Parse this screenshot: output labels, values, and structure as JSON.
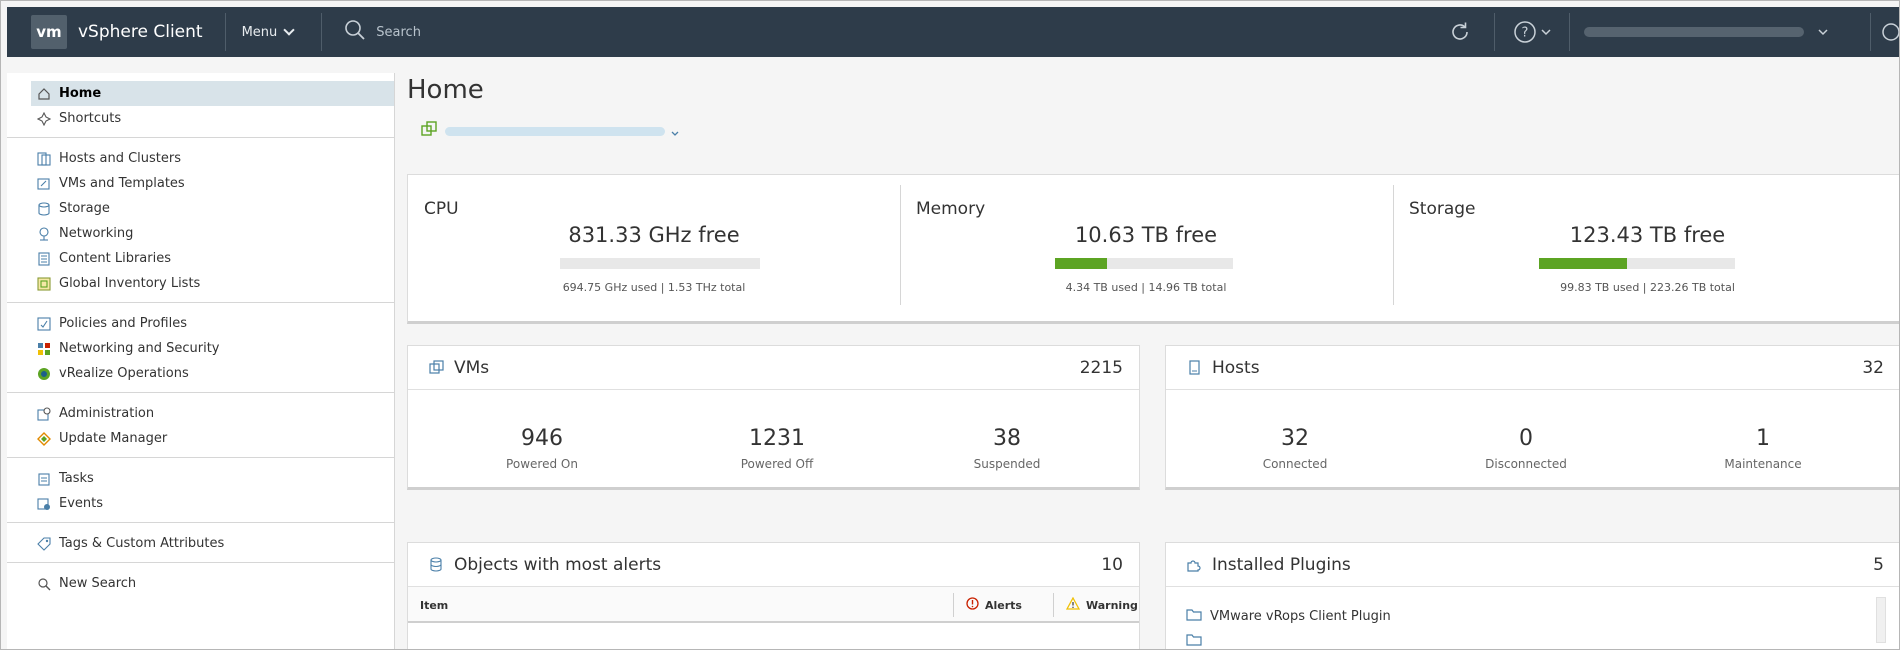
{
  "header": {
    "logo_text": "vm",
    "app_title": "vSphere Client",
    "menu_label": "Menu",
    "search_placeholder": "Search",
    "icons": [
      "search-icon",
      "refresh-icon",
      "help-icon",
      "chevron-down-icon",
      "user-icon"
    ]
  },
  "sidebar": {
    "groups": [
      [
        {
          "label": "Home",
          "icon": "home-icon",
          "active": true
        },
        {
          "label": "Shortcuts",
          "icon": "shortcuts-icon"
        }
      ],
      [
        {
          "label": "Hosts and Clusters",
          "icon": "hosts-clusters-icon"
        },
        {
          "label": "VMs and Templates",
          "icon": "vms-templates-icon"
        },
        {
          "label": "Storage",
          "icon": "storage-icon"
        },
        {
          "label": "Networking",
          "icon": "networking-icon"
        },
        {
          "label": "Content Libraries",
          "icon": "content-libraries-icon"
        },
        {
          "label": "Global Inventory Lists",
          "icon": "inventory-lists-icon"
        }
      ],
      [
        {
          "label": "Policies and Profiles",
          "icon": "policies-icon"
        },
        {
          "label": "Networking and Security",
          "icon": "network-security-icon"
        },
        {
          "label": "vRealize Operations",
          "icon": "vrealize-icon"
        }
      ],
      [
        {
          "label": "Administration",
          "icon": "administration-icon"
        },
        {
          "label": "Update Manager",
          "icon": "update-manager-icon"
        }
      ],
      [
        {
          "label": "Tasks",
          "icon": "tasks-icon"
        },
        {
          "label": "Events",
          "icon": "events-icon"
        }
      ],
      [
        {
          "label": "Tags & Custom Attributes",
          "icon": "tag-icon"
        }
      ],
      [
        {
          "label": "New Search",
          "icon": "search-icon"
        }
      ]
    ]
  },
  "main": {
    "title": "Home",
    "resources": {
      "cpu": {
        "title": "CPU",
        "free": "831.33 GHz free",
        "usage": "694.75 GHz used | 1.53 THz total",
        "used_fraction": 0.0
      },
      "memory": {
        "title": "Memory",
        "free": "10.63 TB free",
        "usage": "4.34 TB used | 14.96 TB total",
        "used_fraction": 0.29
      },
      "storage": {
        "title": "Storage",
        "free": "123.43 TB free",
        "usage": "99.83 TB used | 223.26 TB total",
        "used_fraction": 0.45
      }
    },
    "vms": {
      "title": "VMs",
      "count": "2215",
      "stats": [
        {
          "value": "946",
          "label": "Powered On"
        },
        {
          "value": "1231",
          "label": "Powered Off"
        },
        {
          "value": "38",
          "label": "Suspended"
        }
      ]
    },
    "hosts": {
      "title": "Hosts",
      "count": "32",
      "stats": [
        {
          "value": "32",
          "label": "Connected"
        },
        {
          "value": "0",
          "label": "Disconnected"
        },
        {
          "value": "1",
          "label": "Maintenance"
        }
      ]
    },
    "alerts": {
      "title": "Objects with most alerts",
      "count": "10",
      "columns": [
        "Item",
        "Alerts",
        "Warning"
      ]
    },
    "plugins": {
      "title": "Installed Plugins",
      "count": "5",
      "items": [
        "VMware vRops Client Plugin"
      ]
    }
  },
  "colors": {
    "header_bg": "#2e3c4a",
    "bar_fill": "#5ca423",
    "active_nav": "#d8e3e9",
    "alert_red": "#c92100",
    "warning_yellow": "#efc006"
  }
}
